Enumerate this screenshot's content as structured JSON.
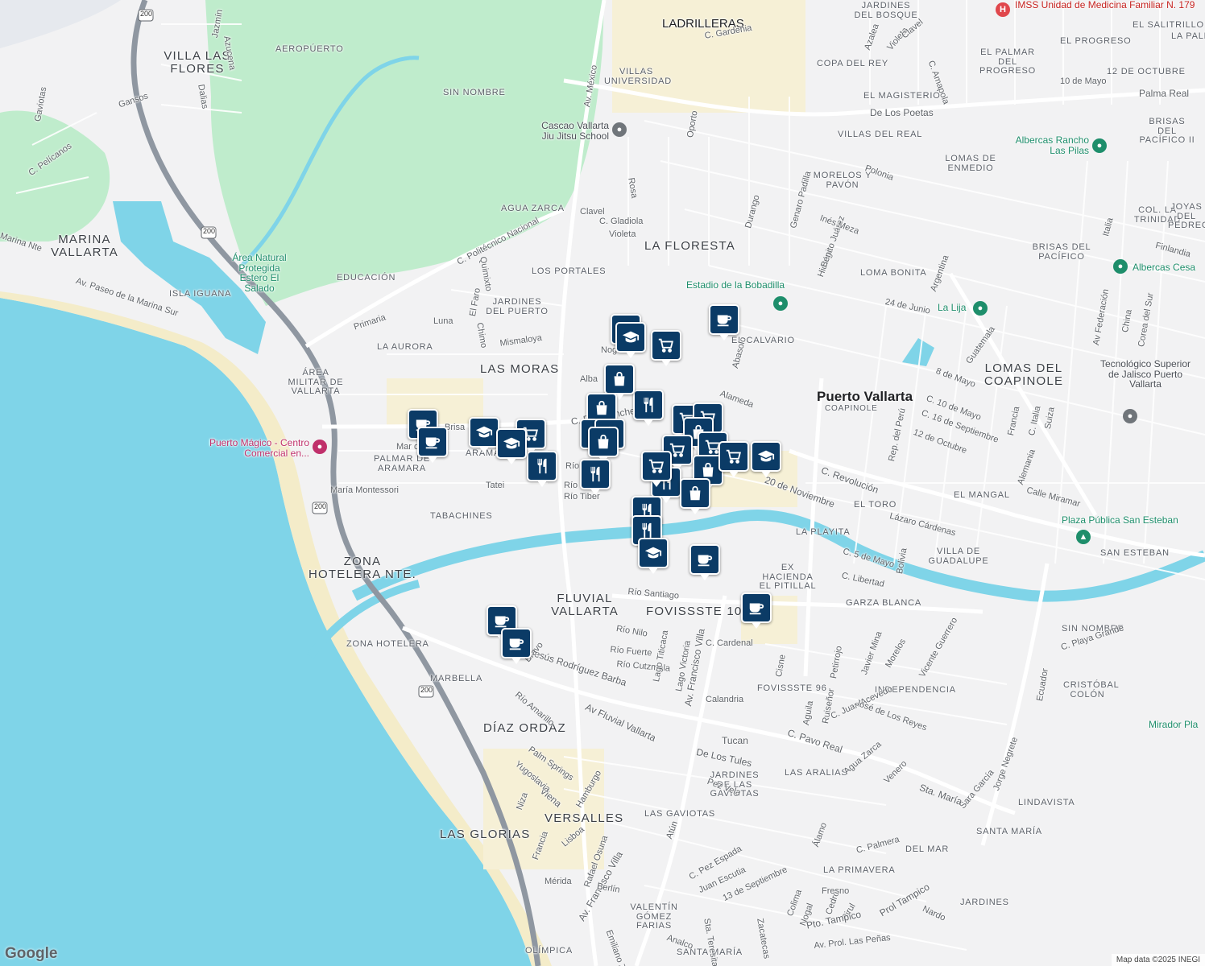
{
  "map": {
    "city": "Puerto Vallarta",
    "neighborhoods": [
      "VILLA LAS FLORES",
      "AEROPÚERTO",
      "SIN NOMBRE",
      "VILLAS UNIVERSIDAD",
      "LADRILLERAS",
      "JARDINES DEL BOSQUE",
      "COPA DEL REY",
      "EL MAGISTERIO",
      "VILLAS DEL REAL",
      "LOMAS DE ENMEDIO",
      "MORELOS Y PAVÓN",
      "LA FLORESTA",
      "LOS PORTALES",
      "EDUCACIÓN",
      "JARDINES DEL PUERTO",
      "LA AURORA",
      "LAS MORAS",
      "EL CALVARIO",
      "COAPINOLE",
      "LOMAS DEL COAPINOLE",
      "LOMA BONITA",
      "BRISAS DEL PACÍFICO",
      "COL. LA TRINIDAD",
      "PALMAR DE ARAMARA",
      "ARAMARA",
      "TABACHINES",
      "ZONA HOTELERA NTE.",
      "FLUVIAL VALLARTA",
      "FOVISSSTE 100",
      "GARZA BLANCA",
      "LA PLAYITA",
      "EX HACIENDA EL PITILLAL",
      "VILLA DE GUADALUPE",
      "SAN ESTEBAN",
      "EL TORO",
      "EL MANGAL",
      "SIN NOMBRE",
      "CRISTÓBAL COLÓN",
      "INDEPENDENCIA",
      "FOVISSSTE 96",
      "ZONA HOTELERA",
      "MARBELLA",
      "DÍAZ ORDAZ",
      "VERSALLES",
      "LAS GLORIAS",
      "LAS ARALIAS",
      "JARDINES DE LAS GAVIOTAS",
      "LAS GAVIOTAS",
      "LINDAVISTA",
      "SANTA MARÍA",
      "DEL MAR",
      "LA PRIMAVERA",
      "JARDINES",
      "VALENTÍN GÓMEZ FARIAS",
      "OLÍMPICA",
      "SANTA MARÍA",
      "MARINA VALLARTA",
      "ISLA IGUANA",
      "EL PROGRESO",
      "EL PALMAR DEL PROGRESO",
      "EL SALITRILLO",
      "LA PALMA",
      "12 DE OCTUBRE",
      "BRISAS DEL PACÍFICO II",
      "JOYAS DEL PEDREGAL"
    ],
    "streets": [
      "Av. México",
      "C. Politécnico Nacional",
      "De Los Poetas",
      "Palma Real",
      "Av. Paseo de la Marina Sur",
      "Marina Nte",
      "C. Pelícanos",
      "Gaviotas",
      "Gansos",
      "Jazmín",
      "Azucena",
      "Dalias",
      "Primaria",
      "Luna",
      "Mismaloya",
      "Quimixto",
      "Chimo",
      "El Faro",
      "Agua Zarca",
      "Clavel",
      "C. Gladiola",
      "Violeta",
      "Rosa",
      "Oporto",
      "Durango",
      "Genaro Padilla",
      "Hidalgo",
      "Benito Juárez",
      "Inés Meza",
      "Polonia",
      "Argentina",
      "Guatemala",
      "24 de Junio",
      "8 de Mayo",
      "C. 10 de Mayo",
      "C. 16 de Septiembre",
      "12 de Octubre",
      "Rep. del Perú",
      "C. Revolución",
      "20 de Noviembre",
      "Alameda",
      "Lázaro Cárdenas",
      "Calle Miramar",
      "Alemania",
      "Av Federación",
      "Corea del Sur",
      "China",
      "Finlandia",
      "Suiza",
      "Italia",
      "C. Italia",
      "Francia",
      "C. 5 de Mayo",
      "Bolivia",
      "C. Libertad",
      "Río Santiago",
      "Río Nilo",
      "Río Fuerte",
      "Río Cutzmala",
      "Lago Titicaca",
      "Lago Victoria",
      "Av. Francisco Villa",
      "C. Cardenal",
      "Cisne",
      "Petirrojo",
      "Javier Mina",
      "Morelos",
      "Vicente Guerrero",
      "Ecuador",
      "C. Playa Grande",
      "Jorge Negrete",
      "Sara García",
      "Sta. María",
      "C. Pavo Real",
      "C. Juan Acevedo",
      "José de Los Reyes",
      "Ruiseñor",
      "Aguila",
      "Calandria",
      "Tucan",
      "De Los Tules",
      "Agua Zarca",
      "Venero",
      "Pez Vela",
      "Atún",
      "C. Pez Espada",
      "Juan Escutia",
      "13 de Septiembre",
      "Colima",
      "Nogal",
      "Cedro",
      "Pirul",
      "Fresno",
      "Álamo",
      "C. Palmera",
      "Nardo",
      "Pto. Tampico",
      "Prol Tampico",
      "Av. Francisco Villa",
      "Rafael Osuna",
      "Berlín",
      "Emiliano Zapata",
      "Analco",
      "Sta. Teresita",
      "Zacatecas",
      "Av. Prol. Las Peñas",
      "Mérida",
      "Francia",
      "Lisboa",
      "Niza",
      "Viena",
      "Hamburgo",
      "Yugoslavia",
      "Palm Springs",
      "Río Amarillo",
      "Av Fluvial Vallarta",
      "Jesús Rodríguez Barba",
      "Bravo",
      "María Montessori",
      "Tatei",
      "Río Tiber",
      "Río Urai",
      "Río",
      "C. Pr... Sánchez",
      "Mar de...",
      "Brisa",
      "10 de Mayo",
      "12 DE OCTUBRE",
      "Azalea",
      "Violeta",
      "Clavel",
      "C. Amapola",
      "C. Gardenia",
      "Abasolo",
      "Nogal",
      "Alba"
    ],
    "pois": [
      {
        "name": "IMSS Unidad de Medicina Familiar N. 179",
        "type": "hospital",
        "color": "#e0474c"
      },
      {
        "name": "Cascao Vallarta Jiu Jitsu School",
        "type": "gym",
        "color": "#70757a"
      },
      {
        "name": "Albercas Rancho Las Pilas",
        "type": "pool",
        "color": "#1e8e6b"
      },
      {
        "name": "Área Natural Protegida Estero El Salado",
        "type": "park",
        "color": "#1e8e6b"
      },
      {
        "name": "Estadio de la Bobadilla",
        "type": "stadium",
        "color": "#1e8e6b"
      },
      {
        "name": "La Lija",
        "type": "pool",
        "color": "#1e8e6b"
      },
      {
        "name": "Albercas Cesa",
        "type": "pool",
        "color": "#1e8e6b"
      },
      {
        "name": "Tecnológico Superior de Jalisco Puerto Vallarta",
        "type": "school",
        "color": "#70757a"
      },
      {
        "name": "Puerto Mágico - Centro Comercial en...",
        "type": "shopping",
        "color": "#c0306b"
      },
      {
        "name": "Plaza Pública San Esteban",
        "type": "park",
        "color": "#1e8e6b"
      },
      {
        "name": "Área Militar de Vallarta",
        "type": "area",
        "color": "#70757a"
      },
      {
        "name": "Mirador Pla",
        "type": "viewpoint",
        "color": "#1e8e6b"
      }
    ],
    "highway_shield": "200",
    "markers": [
      {
        "type": "cafe"
      },
      {
        "type": "cafe"
      },
      {
        "type": "school"
      },
      {
        "type": "school"
      },
      {
        "type": "cart"
      },
      {
        "type": "restaurant"
      },
      {
        "type": "school"
      },
      {
        "type": "cart"
      },
      {
        "type": "bag"
      },
      {
        "type": "bag"
      },
      {
        "type": "restaurant"
      },
      {
        "type": "bag"
      },
      {
        "type": "bag"
      },
      {
        "type": "restaurant"
      },
      {
        "type": "cart"
      },
      {
        "type": "cart"
      },
      {
        "type": "bag"
      },
      {
        "type": "cart"
      },
      {
        "type": "cart"
      },
      {
        "type": "school"
      },
      {
        "type": "bag"
      },
      {
        "type": "restaurant"
      },
      {
        "type": "restaurant"
      },
      {
        "type": "bag"
      },
      {
        "type": "restaurant"
      },
      {
        "type": "restaurant"
      },
      {
        "type": "school"
      },
      {
        "type": "cafe"
      },
      {
        "type": "cafe"
      },
      {
        "type": "cafe"
      },
      {
        "type": "cafe"
      },
      {
        "type": "cafe"
      },
      {
        "type": "school"
      },
      {
        "type": "cart"
      },
      {
        "type": "cart"
      }
    ],
    "google_logo": "Google",
    "attribution": "Map data ©2025 INEGI",
    "colors": {
      "ocean": "#7fd4e8",
      "park": "#bfeccc",
      "highway": "#8f97a1",
      "road": "#ffffff",
      "marker": "#0b3b66"
    }
  }
}
